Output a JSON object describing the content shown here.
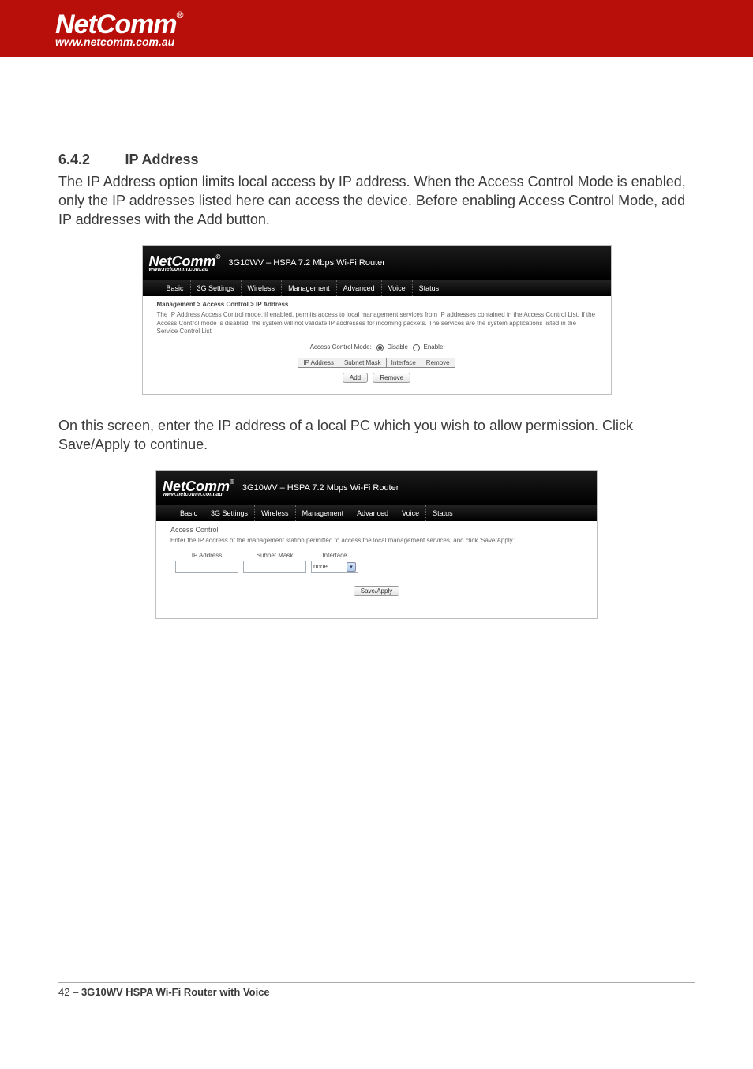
{
  "header": {
    "brand": "NetComm",
    "reg": "®",
    "url": "www.netcomm.com.au"
  },
  "section": {
    "number": "6.4.2",
    "title": "IP Address"
  },
  "para1": "The IP Address option limits local access by IP address. When the Access Control Mode is enabled, only the IP addresses listed here can access the device. Before enabling Access Control Mode, add IP addresses with the Add button.",
  "para2": "On this screen, enter the IP address of a local PC which you wish to allow permission. Click Save/Apply to continue.",
  "router": {
    "brand": "NetComm",
    "url": "www.netcomm.com.au",
    "title": "3G10WV – HSPA 7.2 Mbps Wi-Fi Router",
    "nav": [
      "Basic",
      "3G Settings",
      "Wireless",
      "Management",
      "Advanced",
      "Voice",
      "Status"
    ]
  },
  "shot1": {
    "breadcrumb": "Management > Access Control > IP Address",
    "desc": "The IP Address Access Control mode, if enabled, permits access to local management services from IP addresses contained in the Access Control List. If the Access Control mode is disabled, the system will not validate IP addresses for incoming packets. The services are the system applications listed in the Service Control List",
    "mode_label": "Access Control Mode:",
    "disable_label": "Disable",
    "enable_label": "Enable",
    "cols": {
      "ip": "IP Address",
      "mask": "Subnet Mask",
      "iface": "Interface",
      "remove": "Remove"
    },
    "buttons": {
      "add": "Add",
      "remove": "Remove"
    }
  },
  "shot2": {
    "heading": "Access Control",
    "instruction": "Enter the IP address of the management station permitted to access the local management services, and click 'Save/Apply.'",
    "cols": {
      "ip": "IP Address",
      "mask": "Subnet Mask",
      "iface": "Interface"
    },
    "select_value": "none",
    "save_button": "Save/Apply"
  },
  "footer": {
    "page": "42",
    "sep": " – ",
    "product": "3G10WV HSPA Wi-Fi Router with Voice"
  }
}
